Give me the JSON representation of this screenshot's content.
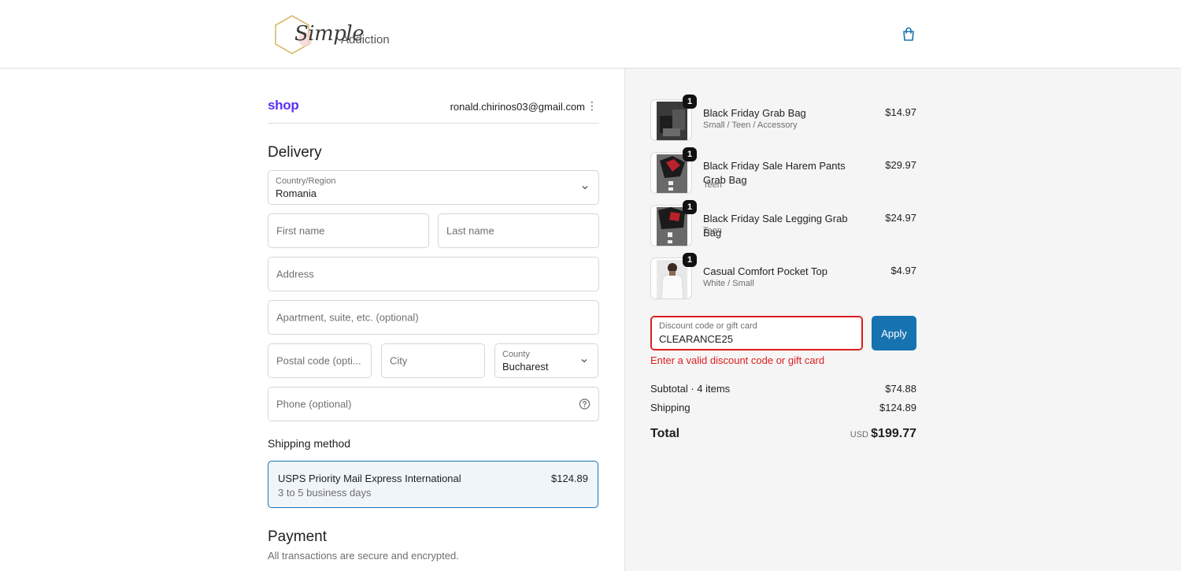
{
  "header": {
    "logo_script": "Simple",
    "logo_sans": "Addiction",
    "cart_icon": "shopping-bag-icon"
  },
  "account": {
    "shop_label": "shop",
    "email": "ronald.chirinos03@gmail.com",
    "menu_icon": "kebab-menu-icon"
  },
  "delivery": {
    "heading": "Delivery",
    "country": {
      "label": "Country/Region",
      "value": "Romania"
    },
    "first_name": {
      "placeholder": "First name"
    },
    "last_name": {
      "placeholder": "Last name"
    },
    "address": {
      "placeholder": "Address"
    },
    "apartment": {
      "placeholder": "Apartment, suite, etc. (optional)"
    },
    "postal": {
      "placeholder": "Postal code (opti..."
    },
    "city": {
      "placeholder": "City"
    },
    "county": {
      "label": "County",
      "value": "Bucharest"
    },
    "phone": {
      "placeholder": "Phone (optional)"
    }
  },
  "shipping": {
    "heading": "Shipping method",
    "option": {
      "name": "USPS Priority Mail Express International",
      "days": "3 to 5 business days",
      "price": "$124.89"
    }
  },
  "payment": {
    "heading": "Payment",
    "subtitle": "All transactions are secure and encrypted."
  },
  "cart": {
    "items": [
      {
        "qty": "1",
        "name": "Black Friday Grab Bag",
        "variant": "Small / Teen / Accessory",
        "price": "$14.97"
      },
      {
        "qty": "1",
        "name": "Black Friday Sale Harem Pants Grab Bag",
        "variant": "Teen",
        "price": "$29.97"
      },
      {
        "qty": "1",
        "name": "Black Friday Sale Legging Grab Bag",
        "variant": "Teen",
        "price": "$24.97"
      },
      {
        "qty": "1",
        "name": "Casual Comfort Pocket Top",
        "variant": "White / Small",
        "price": "$4.97"
      }
    ]
  },
  "discount": {
    "label": "Discount code or gift card",
    "value": "CLEARANCE25",
    "apply_label": "Apply",
    "error": "Enter a valid discount code or gift card"
  },
  "totals": {
    "subtotal_label": "Subtotal · 4 items",
    "subtotal_value": "$74.88",
    "shipping_label": "Shipping",
    "shipping_value": "$124.89",
    "total_label": "Total",
    "currency": "USD",
    "total_value": "$199.77"
  },
  "colors": {
    "accent": "#1773b0",
    "error": "#dd1d1d",
    "shop_purple": "#5a31f4"
  }
}
